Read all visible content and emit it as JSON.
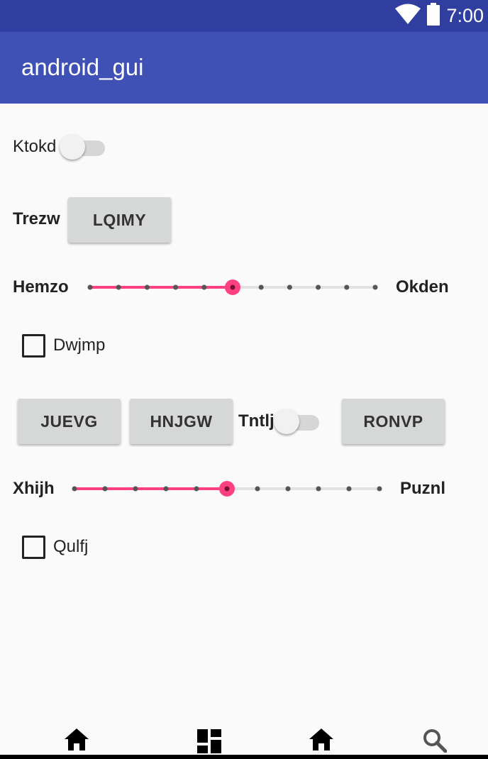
{
  "status_bar": {
    "time": "7:00",
    "icons": [
      "wifi-icon",
      "battery-icon"
    ]
  },
  "app_bar": {
    "title": "android_gui"
  },
  "rows": {
    "switch1": {
      "label": "Ktokd",
      "checked": false
    },
    "button_row": {
      "label": "Trezw",
      "button": "LQIMY"
    },
    "slider1": {
      "left_label": "Hemzo",
      "right_label": "Okden",
      "value": 5,
      "max": 10
    },
    "checkbox1": {
      "label": "Dwjmp",
      "checked": false
    },
    "button_group": {
      "button1": "JUEVG",
      "button2": "HNJGW",
      "switch_label": "Tntlj",
      "switch_checked": false,
      "button3": "RONVP"
    },
    "slider2": {
      "left_label": "Xhijh",
      "right_label": "Puznl",
      "value": 5,
      "max": 10
    },
    "checkbox2": {
      "label": "Qulfj",
      "checked": false
    }
  },
  "bottom_nav": {
    "icons": [
      "home-icon",
      "dashboard-icon",
      "home-icon",
      "search-icon"
    ]
  },
  "colors": {
    "status_bar": "#303f9f",
    "app_bar": "#3f51b5",
    "accent": "#ff4081",
    "button": "#d6d7d7"
  }
}
